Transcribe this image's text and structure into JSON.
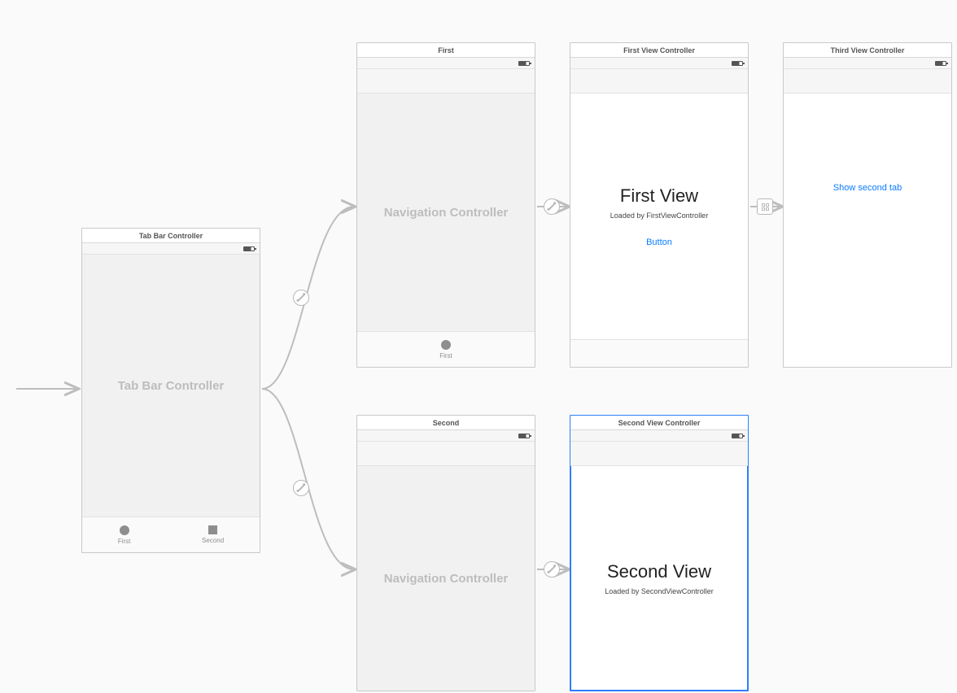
{
  "entryArrow": {
    "label": ""
  },
  "tabBarController": {
    "title": "Tab Bar Controller",
    "bodyLabel": "Tab Bar Controller",
    "tabs": [
      {
        "label": "First",
        "icon": "circle"
      },
      {
        "label": "Second",
        "icon": "square"
      }
    ]
  },
  "navFirst": {
    "title": "First",
    "bodyLabel": "Navigation Controller",
    "tabItem": {
      "label": "First",
      "icon": "circle"
    }
  },
  "navSecond": {
    "title": "Second",
    "bodyLabel": "Navigation Controller"
  },
  "firstVC": {
    "title": "First View Controller",
    "heading": "First View",
    "subtitle": "Loaded by FirstViewController",
    "buttonLabel": "Button"
  },
  "secondVC": {
    "title": "Second View Controller",
    "heading": "Second View",
    "subtitle": "Loaded by SecondViewController"
  },
  "thirdVC": {
    "title": "Third View Controller",
    "linkLabel": "Show second tab"
  },
  "colors": {
    "tint": "#0a7bff",
    "gray": "#bdbdbd",
    "selection": "#2d7ff9"
  }
}
